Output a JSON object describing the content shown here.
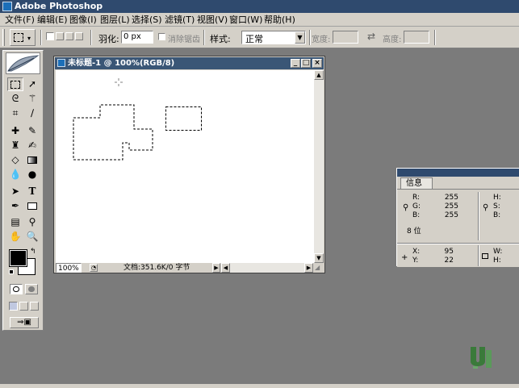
{
  "app": {
    "title": "Adobe Photoshop"
  },
  "menu": [
    "文件(F)",
    "编辑(E)",
    "图像(I)",
    "图层(L)",
    "选择(S)",
    "滤镜(T)",
    "视图(V)",
    "窗口(W)",
    "帮助(H)"
  ],
  "options": {
    "feather_label": "羽化:",
    "feather_value": "0 px",
    "antialias_label": "消除锯齿",
    "style_label": "样式:",
    "style_value": "正常",
    "width_label": "宽度:",
    "height_label": "高度:"
  },
  "document": {
    "title": "未标题-1 @ 100%(RGB/8)",
    "zoom": "100%",
    "doc_size": "文档:351.6K/0 字节"
  },
  "info": {
    "tab": "信息",
    "r_label": "R:",
    "r_value": "255",
    "g_label": "G:",
    "g_value": "255",
    "b_label": "B:",
    "b_value": "255",
    "h_label": "H:",
    "s_label": "S:",
    "b2_label": "B:",
    "bit_depth": "8 位",
    "x_label": "X:",
    "x_value": "95",
    "y_label": "Y:",
    "y_value": "22",
    "w_label": "W:",
    "h2_label": "H:"
  },
  "colors": {
    "titlebar": "#2f4a6e",
    "workspace": "#7b7b7b",
    "chrome": "#d4d0c8",
    "logo": "#3a7a3a"
  },
  "icons": [
    "photoshop-icon",
    "marquee-icon",
    "move-icon",
    "lasso-icon",
    "magic-wand-icon",
    "crop-icon",
    "slice-icon",
    "healing-brush-icon",
    "brush-icon",
    "clone-stamp-icon",
    "history-brush-icon",
    "eraser-icon",
    "gradient-icon",
    "blur-icon",
    "dodge-icon",
    "path-select-icon",
    "type-icon",
    "pen-icon",
    "shape-icon",
    "notes-icon",
    "eyedropper-icon",
    "hand-icon",
    "zoom-icon"
  ]
}
